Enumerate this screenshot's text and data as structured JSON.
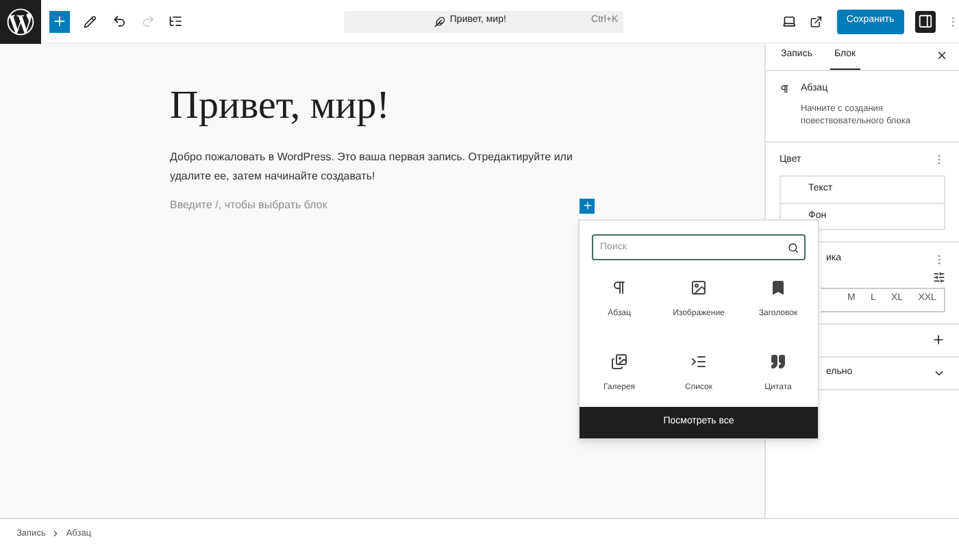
{
  "toolbar": {
    "undo": {
      "disabled": false
    },
    "redo": {
      "disabled": true
    },
    "command_bar": {
      "title": "Привет, мир!",
      "shortcut": "Ctrl+K"
    },
    "save_label": "Сохранить",
    "sidebar_toggle": {
      "on": true
    }
  },
  "editor": {
    "title": "Привет, мир!",
    "paragraph": "Добро пожаловать в WordPress. Это ваша первая запись. Отредактируйте или удалите ее, затем начинайте создавать!",
    "placeholder": "Введите /, чтобы выбрать блок"
  },
  "inserter": {
    "search_placeholder": "Поиск",
    "blocks": [
      {
        "kind": "paragraph",
        "label": "Абзац"
      },
      {
        "kind": "image",
        "label": "Изображение"
      },
      {
        "kind": "heading",
        "label": "Заголовок"
      },
      {
        "kind": "gallery",
        "label": "Галерея"
      },
      {
        "kind": "list",
        "label": "Список"
      },
      {
        "kind": "quote",
        "label": "Цитата"
      }
    ],
    "browse_all": "Посмотреть все"
  },
  "sidebar": {
    "tabs": [
      {
        "label": "Запись",
        "selected": false
      },
      {
        "label": "Блок",
        "selected": true
      }
    ],
    "block": {
      "name": "Абзац",
      "description": "Начните с создания повествовательного блока"
    },
    "color": {
      "title": "Цвет",
      "items": [
        "Текст",
        "Фон"
      ]
    },
    "typography": {
      "title": "ика",
      "sizes": [
        {
          "label": "M",
          "selected": false
        },
        {
          "label": "L",
          "selected": false
        },
        {
          "label": "XL",
          "selected": false
        },
        {
          "label": "XXL",
          "selected": false
        }
      ]
    },
    "advanced": {
      "title": "ельно",
      "expanded": false
    }
  },
  "breadcrumb": [
    "Запись",
    "Абзац"
  ]
}
